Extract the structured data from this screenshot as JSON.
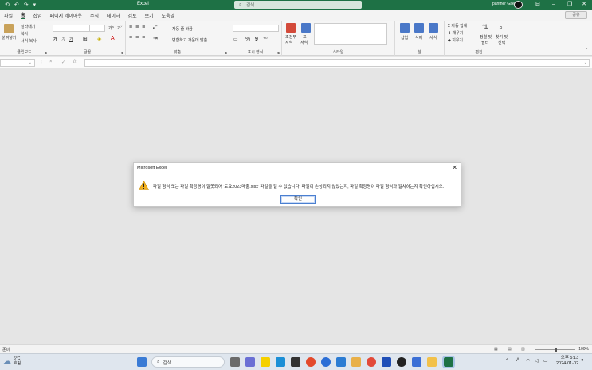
{
  "window": {
    "app_title": "Excel",
    "search_placeholder": "검색",
    "user_name": "panther Gaei",
    "quick_access": [
      "⟲",
      "↶",
      "↷",
      "▾"
    ]
  },
  "menu": {
    "tabs": [
      "파일",
      "홈",
      "삽입",
      "페이지 레이아웃",
      "수식",
      "데이터",
      "검토",
      "보기",
      "도움말"
    ],
    "active": "홈",
    "share_label": "공유"
  },
  "ribbon": {
    "clipboard": {
      "paste": "붙여넣기",
      "cut": "잘라내기",
      "copy": "복사",
      "format_painter": "서식 복사",
      "label": "클립보드"
    },
    "font": {
      "bold": "가",
      "italic": "가",
      "underline": "가",
      "grow": "가^",
      "shrink": "가ˇ",
      "label": "글꼴"
    },
    "alignment": {
      "wrap_text": "자동 줄 바꿈",
      "merge_center": "병합하고 가운데 맞춤",
      "label": "맞춤"
    },
    "number": {
      "percent": "%",
      "comma": "9",
      "label": "표시 형식"
    },
    "styles": {
      "conditional": "조건부",
      "conditional2": "서식",
      "table": "표",
      "table2": "서식",
      "label": "스타일"
    },
    "cells": {
      "insert": "삽입",
      "delete": "삭제",
      "format": "서식",
      "label": "셀"
    },
    "editing": {
      "autosum": "자동 합계",
      "fill": "채우기",
      "clear": "지우기",
      "sort_filter": "정렬 및",
      "sort_filter2": "필터",
      "find_select": "찾기 및",
      "find_select2": "선택",
      "label": "편집"
    }
  },
  "formula_bar": {
    "cancel": "×",
    "enter": "✓",
    "fx": "fx"
  },
  "dialog": {
    "title": "Microsoft Excel",
    "close": "✕",
    "message": "파일 형식 또는 파일 확장명이 잘못되어 '토요2023매출.xlsx' 파일을 열 수 없습니다. 파일이 손상되지 않았는지, 파일 확장명이 파일 형식과 일치하는지 확인하십시오.",
    "ok_label": "확인",
    "icon": "warning-icon"
  },
  "status_bar": {
    "state": "준비",
    "zoom": "100%"
  },
  "taskbar": {
    "temp": "6°C",
    "weather": "흐림",
    "search": "검색",
    "time": "오후 5:13",
    "date": "2024-01-02",
    "lang": "A"
  },
  "colors": {
    "excel_green": "#1e7145",
    "warning": "#f2b01e",
    "accent_blue": "#4a7fd0"
  }
}
